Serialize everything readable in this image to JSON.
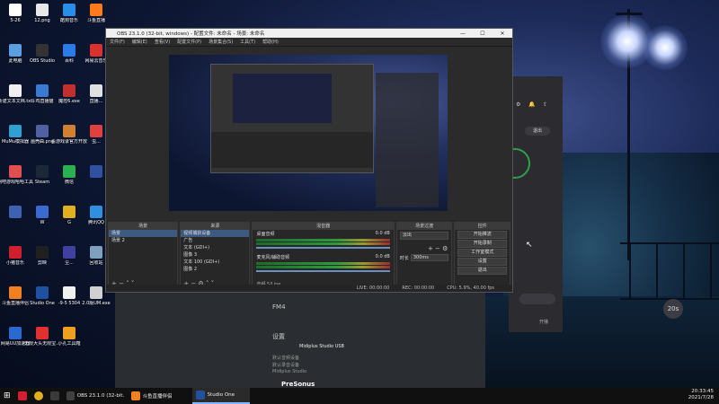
{
  "desktop_icons": [
    {
      "label": "5-26",
      "color": "#ffffff"
    },
    {
      "label": "12.png",
      "color": "#e8e8e8"
    },
    {
      "label": "酷狗音乐",
      "color": "#2a8de8"
    },
    {
      "label": "斗鱼直播",
      "color": "#ff7a1a"
    },
    {
      "label": "此电脑",
      "color": "#5aa0e0"
    },
    {
      "label": "OBS Studio",
      "color": "#333333"
    },
    {
      "label": "百科",
      "color": "#2a7be8"
    },
    {
      "label": "网易云音乐",
      "color": "#d93030"
    },
    {
      "label": "新建文本文档.txt",
      "color": "#f0f0f0"
    },
    {
      "label": "斗鸡直播猫",
      "color": "#3a7ad0"
    },
    {
      "label": "魔控6.exe",
      "color": "#c03030"
    },
    {
      "label": "直播...",
      "color": "#e0e0e0"
    },
    {
      "label": "MuMu模拟器",
      "color": "#30a0d0"
    },
    {
      "label": "画壳曲.png",
      "color": "#5060a0"
    },
    {
      "label": "看游戏录官方开放平台",
      "color": "#d08030"
    },
    {
      "label": "虫...",
      "color": "#e04040"
    },
    {
      "label": "网吧游戏哈哈工具",
      "color": "#e05050"
    },
    {
      "label": "Steam",
      "color": "#1b2838"
    },
    {
      "label": "微信",
      "color": "#2ab050"
    },
    {
      "label": "",
      "color": "#3050a0"
    },
    {
      "label": "",
      "color": "#4060b0"
    },
    {
      "label": "W",
      "color": "#3a6ad0"
    },
    {
      "label": "G",
      "color": "#e0b020"
    },
    {
      "label": "腾讯QQ",
      "color": "#3090e0"
    },
    {
      "label": "小猪音乐",
      "color": "#d02030"
    },
    {
      "label": "剪映",
      "color": "#202020"
    },
    {
      "label": "尘...",
      "color": "#4040a0"
    },
    {
      "label": "回收站",
      "color": "#80a0c0"
    },
    {
      "label": "斗鱼直播伴侣",
      "color": "#f08020"
    },
    {
      "label": "Studio One",
      "color": "#2050a0"
    },
    {
      "label": "-9-5 5304",
      "color": "#f0f0f0"
    },
    {
      "label": "2.0版UM.exe",
      "color": "#d0d0d0"
    },
    {
      "label": "网易UU加速器",
      "color": "#2a6ad0"
    },
    {
      "label": "无限大头无限宝...",
      "color": "#e03030"
    },
    {
      "label": "小孔工具箱",
      "color": "#f0a020"
    }
  ],
  "obs": {
    "title": "OBS 23.1.0 (32-bit, windows) - 配置文件: 未命名 - 场景: 未命名",
    "window_controls": [
      "—",
      "☐",
      "✕"
    ],
    "menu": [
      "文件(F)",
      "编辑(E)",
      "查看(V)",
      "配置文件(P)",
      "场景集合(S)",
      "工具(T)",
      "帮助(H)"
    ],
    "docks": {
      "scenes": {
        "title": "场景",
        "items": [
          "场景",
          "场景 2"
        ]
      },
      "sources": {
        "title": "来源",
        "items": [
          "视频捕获设备",
          "广告",
          "文本 (GDI+)",
          "图像 3",
          "文本 100 (GDI+)",
          "图像 2"
        ]
      },
      "mixer": {
        "title": "混音器",
        "channels": [
          {
            "name": "桌面音频",
            "db": "0.0 dB"
          },
          {
            "name": "麦克风/辅助音频",
            "db": "0.0 dB"
          }
        ],
        "footer": "音频 5/Line"
      },
      "transitions": {
        "title": "场景过渡",
        "type": "淡出",
        "duration_label": "时长",
        "duration": "300ms"
      },
      "controls": {
        "title": "控件",
        "buttons": [
          "开始推流",
          "开始录制",
          "工作室模式",
          "设置",
          "退出"
        ]
      }
    },
    "statusbar": [
      "LIVE: 00:00:00",
      "REC: 00:00:00",
      "CPU: 5.9%, 40.00 fps"
    ]
  },
  "studio_one": {
    "section1": "FM4",
    "section2": "设置",
    "device": "Midiplus Studio USB",
    "items": [
      "默认音频设备",
      "默认录音设备",
      "Midiplus Studio"
    ],
    "brand": "PreSonus"
  },
  "right_panel": {
    "exit_label": "退出",
    "badge": "20s",
    "bottom_label": "开播"
  },
  "taskbar": {
    "items": [
      {
        "label": "OBS 23.1.0 (32-bit...",
        "color": "#404040"
      },
      {
        "label": "斗鱼直播伴侣",
        "color": "#f08020"
      },
      {
        "label": "Studio One",
        "color": "#2050a0"
      }
    ],
    "time": "20:33:45",
    "date": "2021/7/28"
  }
}
